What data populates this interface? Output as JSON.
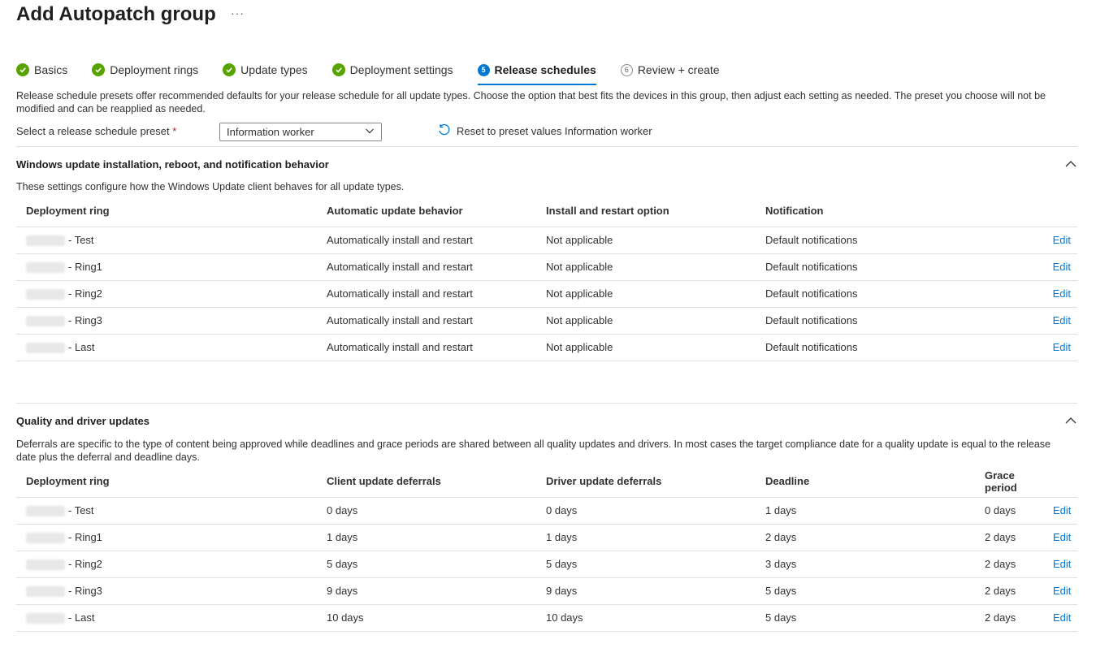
{
  "header": {
    "title": "Add Autopatch group",
    "more": "···"
  },
  "tabs": [
    {
      "label": "Basics",
      "state": "done"
    },
    {
      "label": "Deployment rings",
      "state": "done"
    },
    {
      "label": "Update types",
      "state": "done"
    },
    {
      "label": "Deployment settings",
      "state": "done"
    },
    {
      "label": "Release schedules",
      "state": "active",
      "number": "5"
    },
    {
      "label": "Review + create",
      "state": "pending",
      "number": "6"
    }
  ],
  "intro": "Release schedule presets offer recommended defaults for your release schedule for all update types. Choose the option that best fits the devices in this group, then adjust each setting as needed. The preset you choose will not be modified and can be reapplied as needed.",
  "preset": {
    "label": "Select a release schedule preset",
    "required_mark": "*",
    "value": "Information worker",
    "reset_label": "Reset to preset values Information worker"
  },
  "windows_section": {
    "title": "Windows update installation, reboot, and notification behavior",
    "description": "These settings configure how the Windows Update client behaves for all update types.",
    "columns": [
      "Deployment ring",
      "Automatic update behavior",
      "Install and restart option",
      "Notification"
    ],
    "rows": [
      {
        "ring": "- Test",
        "behavior": "Automatically install and restart",
        "option": "Not applicable",
        "notification": "Default notifications",
        "action": "Edit"
      },
      {
        "ring": "- Ring1",
        "behavior": "Automatically install and restart",
        "option": "Not applicable",
        "notification": "Default notifications",
        "action": "Edit"
      },
      {
        "ring": "- Ring2",
        "behavior": "Automatically install and restart",
        "option": "Not applicable",
        "notification": "Default notifications",
        "action": "Edit"
      },
      {
        "ring": "- Ring3",
        "behavior": "Automatically install and restart",
        "option": "Not applicable",
        "notification": "Default notifications",
        "action": "Edit"
      },
      {
        "ring": "- Last",
        "behavior": "Automatically install and restart",
        "option": "Not applicable",
        "notification": "Default notifications",
        "action": "Edit"
      }
    ]
  },
  "quality_section": {
    "title": "Quality and driver updates",
    "description": "Deferrals are specific to the type of content being approved while deadlines and grace periods are shared between all quality updates and drivers. In most cases the target compliance date for a quality update is equal to the release date plus the deferral and deadline days.",
    "columns": [
      "Deployment ring",
      "Client update deferrals",
      "Driver update deferrals",
      "Deadline",
      "Grace period"
    ],
    "rows": [
      {
        "ring": "- Test",
        "client": "0 days",
        "driver": "0 days",
        "deadline": "1 days",
        "grace": "0 days",
        "action": "Edit"
      },
      {
        "ring": "- Ring1",
        "client": "1 days",
        "driver": "1 days",
        "deadline": "2 days",
        "grace": "2 days",
        "action": "Edit"
      },
      {
        "ring": "- Ring2",
        "client": "5 days",
        "driver": "5 days",
        "deadline": "3 days",
        "grace": "2 days",
        "action": "Edit"
      },
      {
        "ring": "- Ring3",
        "client": "9 days",
        "driver": "9 days",
        "deadline": "5 days",
        "grace": "2 days",
        "action": "Edit"
      },
      {
        "ring": "- Last",
        "client": "10 days",
        "driver": "10 days",
        "deadline": "5 days",
        "grace": "2 days",
        "action": "Edit"
      }
    ]
  },
  "colors": {
    "accent": "#0078d4",
    "success": "#57a300",
    "border": "#e1dfdd"
  }
}
